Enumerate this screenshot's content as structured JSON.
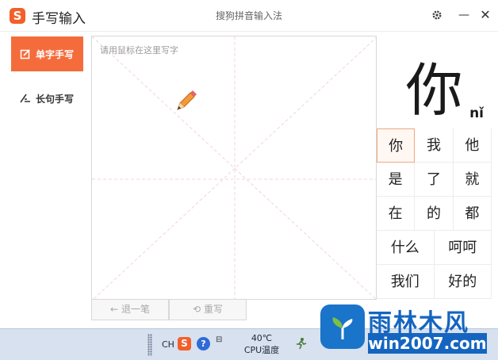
{
  "app": {
    "title": "手写输入",
    "logo_letter": "S",
    "subtitle": "搜狗拼音输入法"
  },
  "titlebar": {
    "settings_icon": "gear-icon",
    "minimize_label": "—",
    "close_label": "✕"
  },
  "sidebar": {
    "items": [
      {
        "label": "单字手写",
        "icon": "edit-square-icon",
        "active": true
      },
      {
        "label": "长句手写",
        "icon": "pen-lines-icon",
        "active": false
      }
    ]
  },
  "canvas": {
    "placeholder": "请用鼠标在这里写字",
    "cursor_icon": "pencil-icon"
  },
  "actions": {
    "undo_label": "退一笔",
    "undo_symbol": "←",
    "rewrite_label": "重写",
    "rewrite_symbol": "⟲"
  },
  "preview": {
    "char": "你",
    "pinyin": "nǐ"
  },
  "candidates": {
    "rows": [
      [
        "你",
        "我",
        "他"
      ],
      [
        "是",
        "了",
        "就"
      ],
      [
        "在",
        "的",
        "都"
      ],
      [
        "什么",
        "呵呵"
      ],
      [
        "我们",
        "好的"
      ]
    ],
    "selected": "你"
  },
  "taskbar": {
    "lang": "CH",
    "ime_letter": "S",
    "help_label": "?",
    "small_glyph": "⊟",
    "cpu_temp": "40℃",
    "cpu_label": "CPU温度"
  },
  "watermark": {
    "brand": "雨林木风",
    "url": "win2007.com"
  },
  "colors": {
    "accent": "#f56c3c",
    "brand_blue": "#1565c0"
  }
}
